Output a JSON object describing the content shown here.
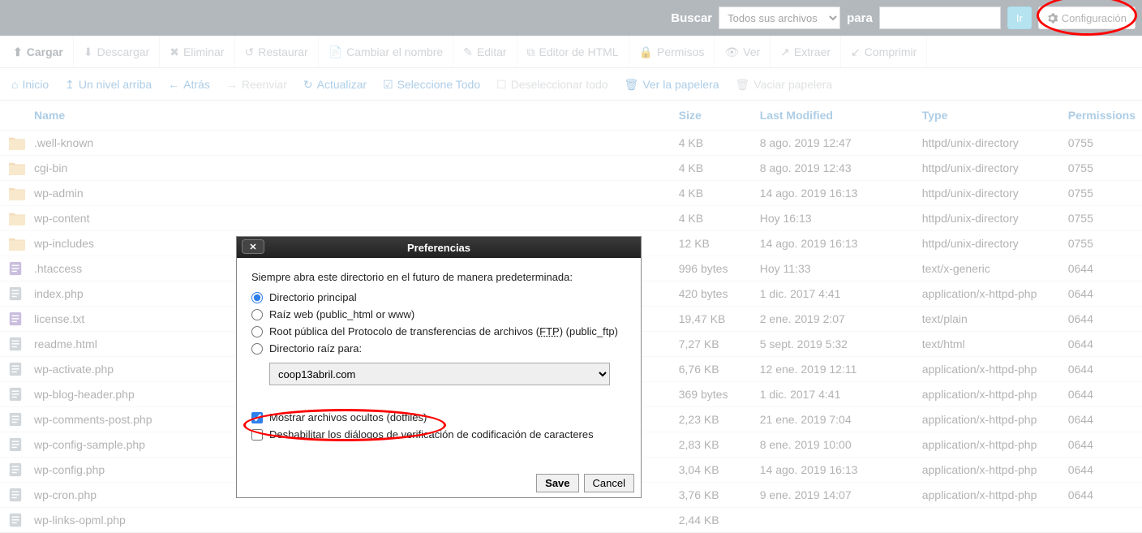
{
  "topbar": {
    "search_label": "Buscar",
    "scope_selected": "Todos sus archivos",
    "for_label": "para",
    "go_label": "Ir",
    "config_label": "Configuración"
  },
  "toolbar": {
    "upload": "Cargar",
    "download": "Descargar",
    "delete": "Eliminar",
    "restore": "Restaurar",
    "rename": "Cambiar el nombre",
    "edit": "Editar",
    "html_editor": "Editor de HTML",
    "permissions": "Permisos",
    "view": "Ver",
    "extract": "Extraer",
    "compress": "Comprimir"
  },
  "nav": {
    "home": "Inicio",
    "up": "Un nivel arriba",
    "back": "Atrás",
    "forward": "Reenviar",
    "reload": "Actualizar",
    "select_all": "Seleccione Todo",
    "deselect_all": "Deseleccionar todo",
    "view_trash": "Ver la papelera",
    "empty_trash": "Vaciar papelera"
  },
  "columns": {
    "name": "Name",
    "size": "Size",
    "modified": "Last Modified",
    "type": "Type",
    "permissions": "Permissions"
  },
  "files": [
    {
      "icon": "folder",
      "name": ".well-known",
      "size": "4 KB",
      "modified": "8 ago. 2019 12:47",
      "type": "httpd/unix-directory",
      "perm": "0755"
    },
    {
      "icon": "folder",
      "name": "cgi-bin",
      "size": "4 KB",
      "modified": "8 ago. 2019 12:43",
      "type": "httpd/unix-directory",
      "perm": "0755"
    },
    {
      "icon": "folder",
      "name": "wp-admin",
      "size": "4 KB",
      "modified": "14 ago. 2019 16:13",
      "type": "httpd/unix-directory",
      "perm": "0755"
    },
    {
      "icon": "folder",
      "name": "wp-content",
      "size": "4 KB",
      "modified": "Hoy 16:13",
      "type": "httpd/unix-directory",
      "perm": "0755"
    },
    {
      "icon": "folder",
      "name": "wp-includes",
      "size": "12 KB",
      "modified": "14 ago. 2019 16:13",
      "type": "httpd/unix-directory",
      "perm": "0755"
    },
    {
      "icon": "file",
      "name": ".htaccess",
      "size": "996 bytes",
      "modified": "Hoy 11:33",
      "type": "text/x-generic",
      "perm": "0644"
    },
    {
      "icon": "php",
      "name": "index.php",
      "size": "420 bytes",
      "modified": "1 dic. 2017 4:41",
      "type": "application/x-httpd-php",
      "perm": "0644"
    },
    {
      "icon": "file",
      "name": "license.txt",
      "size": "19,47 KB",
      "modified": "2 ene. 2019 2:07",
      "type": "text/plain",
      "perm": "0644"
    },
    {
      "icon": "php",
      "name": "readme.html",
      "size": "7,27 KB",
      "modified": "5 sept. 2019 5:32",
      "type": "text/html",
      "perm": "0644"
    },
    {
      "icon": "php",
      "name": "wp-activate.php",
      "size": "6,76 KB",
      "modified": "12 ene. 2019 12:11",
      "type": "application/x-httpd-php",
      "perm": "0644"
    },
    {
      "icon": "php",
      "name": "wp-blog-header.php",
      "size": "369 bytes",
      "modified": "1 dic. 2017 4:41",
      "type": "application/x-httpd-php",
      "perm": "0644"
    },
    {
      "icon": "php",
      "name": "wp-comments-post.php",
      "size": "2,23 KB",
      "modified": "21 ene. 2019 7:04",
      "type": "application/x-httpd-php",
      "perm": "0644"
    },
    {
      "icon": "php",
      "name": "wp-config-sample.php",
      "size": "2,83 KB",
      "modified": "8 ene. 2019 10:00",
      "type": "application/x-httpd-php",
      "perm": "0644"
    },
    {
      "icon": "php",
      "name": "wp-config.php",
      "size": "3,04 KB",
      "modified": "14 ago. 2019 16:13",
      "type": "application/x-httpd-php",
      "perm": "0644"
    },
    {
      "icon": "php",
      "name": "wp-cron.php",
      "size": "3,76 KB",
      "modified": "9 ene. 2019 14:07",
      "type": "application/x-httpd-php",
      "perm": "0644"
    },
    {
      "icon": "php",
      "name": "wp-links-opml.php",
      "size": "2,44 KB",
      "modified": "",
      "type": "",
      "perm": ""
    }
  ],
  "dialog": {
    "title": "Preferencias",
    "instruction": "Siempre abra este directorio en el futuro de manera predeterminada:",
    "r1": "Directorio principal",
    "r2": "Raíz web (public_html or www)",
    "r3_a": "Root pública del Protocolo de transferencias de archivos (",
    "r3_u": "FTP",
    "r3_b": ") (public_ftp)",
    "r4": "Directorio raíz para:",
    "domain": "coop13abril.com",
    "cb1": "Mostrar archivos ocultos (dotfiles)",
    "cb2": "Deshabilitar los diálogos de verificación de codificación de caracteres",
    "save": "Save",
    "cancel": "Cancel"
  }
}
